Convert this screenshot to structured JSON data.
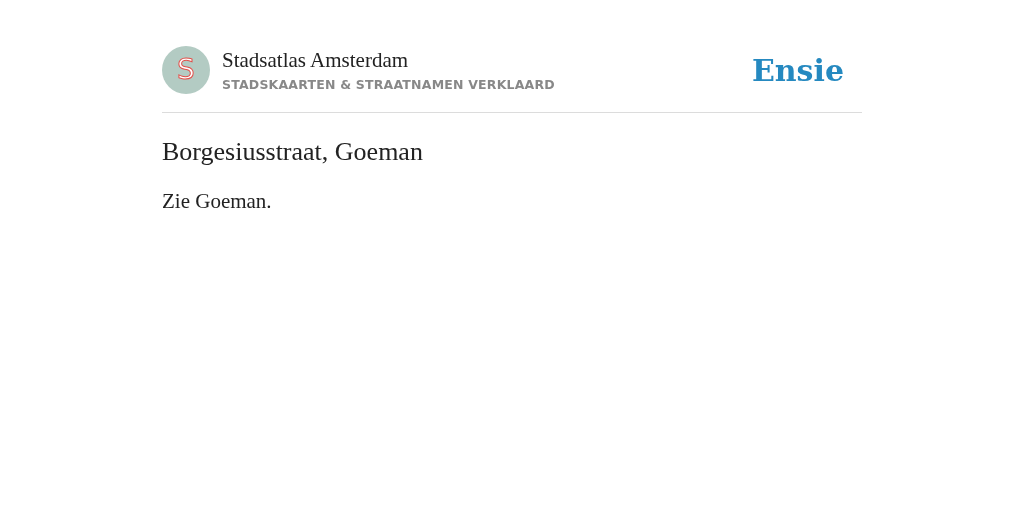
{
  "header": {
    "logo_letter": "S",
    "site_title": "Stadsatlas Amsterdam",
    "tagline": "STADSKAARTEN & STRAATNAMEN VERKLAARD",
    "brand": "Ensie"
  },
  "article": {
    "title": "Borgesiusstraat, Goeman",
    "body": "Zie Goeman."
  }
}
